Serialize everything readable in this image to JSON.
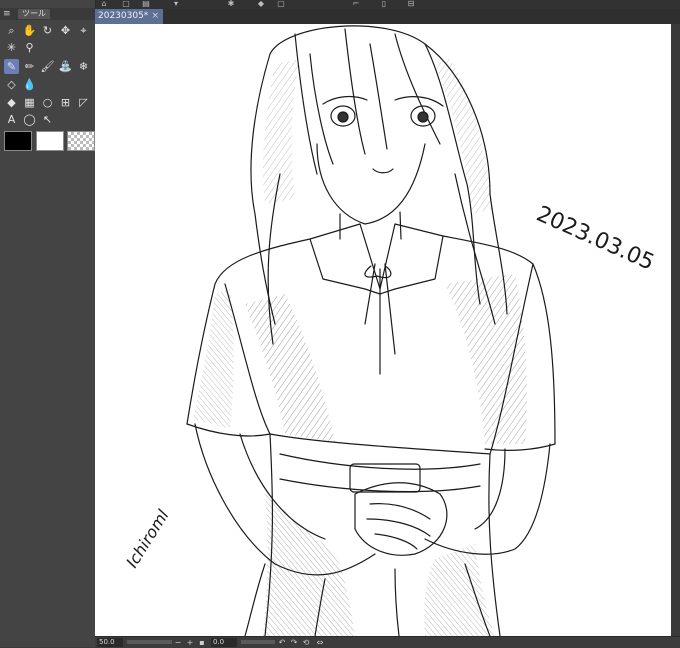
{
  "sidebar": {
    "menu_icon": "menu-icon",
    "tab_label": "ツール",
    "tools": [
      {
        "name": "zoom-tool",
        "glyph": "⌕",
        "selected": false
      },
      {
        "name": "hand-tool",
        "glyph": "✋",
        "selected": false
      },
      {
        "name": "rotate-tool",
        "glyph": "↻",
        "selected": false
      },
      {
        "name": "move-tool",
        "glyph": "✥",
        "selected": false
      },
      {
        "name": "operation-tool",
        "glyph": "⌖",
        "selected": false
      },
      {
        "name": "auto-select-tool",
        "glyph": "✳",
        "selected": false
      },
      {
        "name": "eyedropper-tool",
        "glyph": "⚲",
        "selected": false
      },
      {
        "name": "pen-tool",
        "glyph": "✎",
        "selected": true
      },
      {
        "name": "pencil-tool",
        "glyph": "✏",
        "selected": false
      },
      {
        "name": "brush-tool",
        "glyph": "🖌",
        "selected": false
      },
      {
        "name": "airbrush-tool",
        "glyph": "⛲",
        "selected": false
      },
      {
        "name": "decoration-tool",
        "glyph": "❄",
        "selected": false
      },
      {
        "name": "eraser-tool",
        "glyph": "◇",
        "selected": false
      },
      {
        "name": "blend-tool",
        "glyph": "💧",
        "selected": false
      },
      {
        "name": "fill-tool",
        "glyph": "◆",
        "selected": false
      },
      {
        "name": "gradient-tool",
        "glyph": "▦",
        "selected": false
      },
      {
        "name": "figure-tool",
        "glyph": "○",
        "selected": false
      },
      {
        "name": "frame-tool",
        "glyph": "⊞",
        "selected": false
      },
      {
        "name": "ruler-tool",
        "glyph": "◸",
        "selected": false
      },
      {
        "name": "text-tool",
        "glyph": "A",
        "selected": false
      },
      {
        "name": "balloon-tool",
        "glyph": "◯",
        "selected": false
      },
      {
        "name": "correct-line-tool",
        "glyph": "↖",
        "selected": false
      }
    ],
    "colors": {
      "main": "#000000",
      "sub": "#ffffff",
      "transparent": "checker"
    }
  },
  "document": {
    "tab_title": "20230305*",
    "close_glyph": "×"
  },
  "artwork": {
    "date_text": "2023.03.05",
    "signature_text": "Ichiroml"
  },
  "statusbar": {
    "zoom_value": "50.0",
    "zoom_minus": "−",
    "zoom_plus": "+",
    "angle_value": "0.0",
    "rotate_left": "↶",
    "rotate_right": "↷",
    "reset": "⟲"
  }
}
